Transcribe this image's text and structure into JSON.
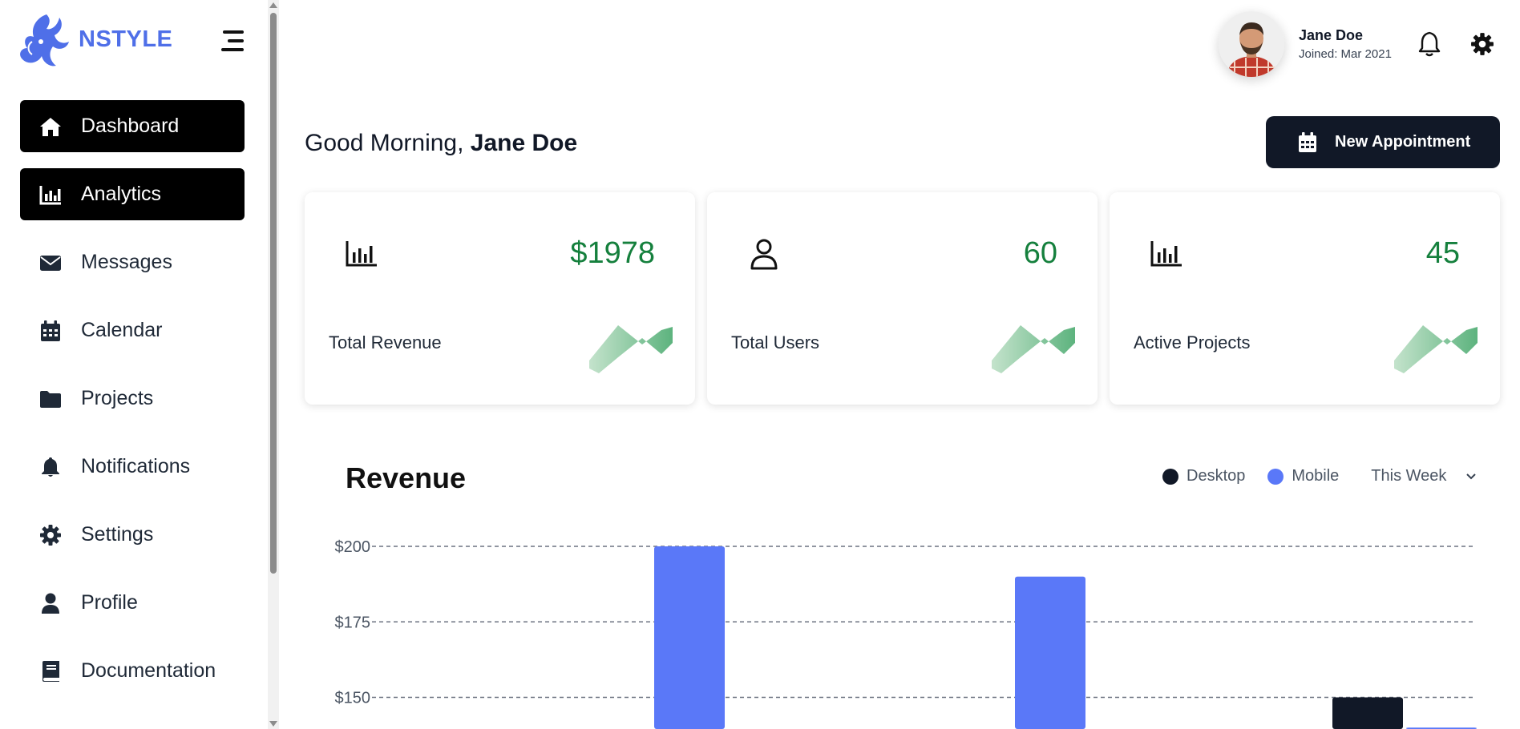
{
  "brand": {
    "name": "NSTYLE"
  },
  "nav": [
    {
      "label": "Dashboard",
      "icon": "home-icon",
      "active": true
    },
    {
      "label": "Analytics",
      "icon": "bar-chart-icon",
      "active": true
    },
    {
      "label": "Messages",
      "icon": "envelope-icon",
      "active": false
    },
    {
      "label": "Calendar",
      "icon": "calendar-icon",
      "active": false
    },
    {
      "label": "Projects",
      "icon": "folder-icon",
      "active": false
    },
    {
      "label": "Notifications",
      "icon": "bell-icon",
      "active": false
    },
    {
      "label": "Settings",
      "icon": "gear-icon",
      "active": false
    },
    {
      "label": "Profile",
      "icon": "user-icon",
      "active": false
    },
    {
      "label": "Documentation",
      "icon": "book-icon",
      "active": false
    }
  ],
  "user": {
    "name": "Jane Doe",
    "joined": "Joined: Mar 2021"
  },
  "greeting": {
    "prefix": "Good Morning,",
    "name": "Jane Doe"
  },
  "appointment_button": {
    "label": "New Appointment"
  },
  "stats": [
    {
      "label": "Total Revenue",
      "value": "$1978",
      "icon": "bar-chart-icon"
    },
    {
      "label": "Total Users",
      "value": "60",
      "icon": "user-outline-icon"
    },
    {
      "label": "Active Projects",
      "value": "45",
      "icon": "bar-chart-icon"
    }
  ],
  "revenue": {
    "title": "Revenue",
    "legend": {
      "desktop": "Desktop",
      "mobile": "Mobile"
    },
    "range": "This Week"
  },
  "colors": {
    "accent": "#5a78f8",
    "dark": "#111827",
    "positive": "#15803d"
  },
  "chart_data": {
    "type": "bar",
    "series": [
      {
        "name": "Desktop",
        "color": "#111827",
        "values": [
          null,
          null,
          150
        ]
      },
      {
        "name": "Mobile",
        "color": "#5a78f8",
        "values": [
          200,
          190,
          140
        ]
      }
    ],
    "ylabel": "",
    "yticks": [
      "$200",
      "$175",
      "$150"
    ],
    "ylim": [
      140,
      200
    ],
    "grid": true
  }
}
